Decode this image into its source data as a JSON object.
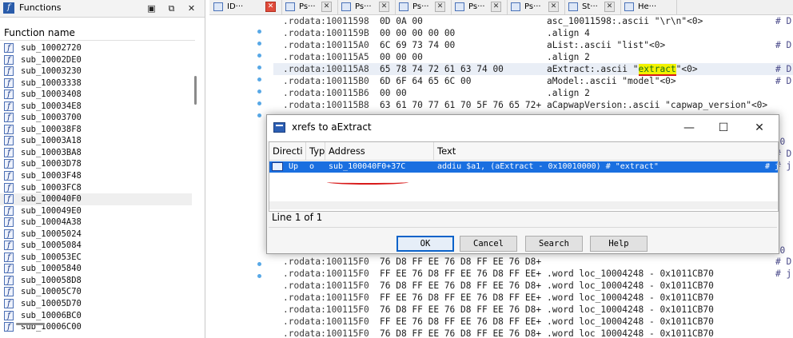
{
  "functions_pane": {
    "title": "Functions",
    "column_header": "Function name",
    "buttons": {
      "maximize": "▣",
      "restore": "⧉",
      "close": "✕"
    },
    "items": [
      "sub_10002720",
      "sub_10002DE0",
      "sub_10003230",
      "sub_10003338",
      "sub_10003408",
      "sub_100034E8",
      "sub_10003700",
      "sub_100038F8",
      "sub_10003A18",
      "sub_10003BA8",
      "sub_10003D78",
      "sub_10003F48",
      "sub_10003FC8",
      "sub_100040F0",
      "sub_100049E0",
      "sub_10004A38",
      "sub_10005024",
      "sub_10005084",
      "sub_100053EC",
      "sub_10005840",
      "sub_100058D8",
      "sub_10005C70",
      "sub_10005D70",
      "sub_10006BC0",
      "sub_10006C00"
    ],
    "selected_index": 13,
    "icon_glyph": "f"
  },
  "tabs": [
    {
      "label": "ID···",
      "close": "✕",
      "close_red": true
    },
    {
      "label": "Ps···",
      "close": "✕"
    },
    {
      "label": "Ps···",
      "close": "✕"
    },
    {
      "label": "Ps···",
      "close": "✕"
    },
    {
      "label": "Ps···",
      "close": "✕"
    },
    {
      "label": "Ps···",
      "close": "✕"
    },
    {
      "label": "St···",
      "close": "✕"
    },
    {
      "label": "He···",
      "close": ""
    }
  ],
  "disassembly": {
    "lines": [
      {
        "addr": ".rodata:10011598",
        "bytes": "0D 0A 00",
        "code": "asc_10011598:.ascii \"\\r\\n\"<0>",
        "comment": "# D"
      },
      {
        "addr": ".rodata:1001159B",
        "bytes": "00 00 00 00 00",
        "code": ".align 4",
        "comment": ""
      },
      {
        "addr": ".rodata:100115A0",
        "bytes": "6C 69 73 74 00",
        "code": "aList:.ascii \"list\"<0>",
        "comment": "# D"
      },
      {
        "addr": ".rodata:100115A5",
        "bytes": "00 00 00",
        "code": ".align 2",
        "comment": ""
      },
      {
        "addr": ".rodata:100115A8",
        "bytes": "65 78 74 72 61 63 74 00",
        "code_pre": "aExtract:.ascii \"",
        "code_hl": "extract",
        "code_post": "\"<0>",
        "comment": "# D",
        "highlight": true
      },
      {
        "addr": ".rodata:100115B0",
        "bytes": "6D 6F 64 65 6C 00",
        "code": "aModel:.ascii \"model\"<0>",
        "comment": "# D"
      },
      {
        "addr": ".rodata:100115B6",
        "bytes": "00 00",
        "code": ".align 2",
        "comment": ""
      },
      {
        "addr": ".rodata:100115B8",
        "bytes": "63 61 70 77 61 70 5F 76 65 72+",
        "code": "aCapwapVersion:.ascii \"capwap_version\"<0>",
        "comment": ""
      }
    ],
    "lower_lines": [
      {
        "addr": ".rodata:100115F0",
        "bytes": "76 D8 FF EE 76 D8 FF EE 76 D8+",
        "code": "",
        "comment": "# D"
      },
      {
        "addr": ".rodata:100115F0",
        "bytes": "FF EE 76 D8 FF EE 76 D8 FF EE+",
        "code": ".word loc_10004248 - 0x1011CB70",
        "comment": "# j"
      },
      {
        "addr": ".rodata:100115F0",
        "bytes": "76 D8 FF EE 76 D8 FF EE 76 D8+",
        "code": ".word loc_10004248 - 0x1011CB70",
        "comment": ""
      },
      {
        "addr": ".rodata:100115F0",
        "bytes": "FF EE 76 D8 FF EE 76 D8 FF EE+",
        "code": ".word loc_10004248 - 0x1011CB70",
        "comment": ""
      },
      {
        "addr": ".rodata:100115F0",
        "bytes": "76 D8 FF EE 76 D8 FF EE 76 D8+",
        "code": ".word loc_10004248 - 0x1011CB70",
        "comment": ""
      },
      {
        "addr": ".rodata:100115F0",
        "bytes": "FF EE 76 D8 FF EE 76 D8 FF EE+",
        "code": ".word loc_10004248 - 0x1011CB70",
        "comment": ""
      },
      {
        "addr": ".rodata:100115F0",
        "bytes": "76 D8 FF EE 76 D8 FF EE 76 D8+",
        "code": ".word loc_10004248 - 0x1011CB70",
        "comment": ""
      }
    ],
    "side_fragments": [
      "370",
      "# D",
      "# j",
      "370"
    ]
  },
  "xrefs_dialog": {
    "title": "xrefs to aExtract",
    "window_buttons": {
      "minimize": "—",
      "maximize": "☐",
      "close": "✕"
    },
    "columns": [
      "Directi",
      "Typ",
      "Address",
      "Text"
    ],
    "rows": [
      {
        "direction": "Up",
        "type": "o",
        "address": "sub_100040F0+37C",
        "text": "addiu   $a1, (aExtract - 0x10010000) # \"extract\"",
        "trail": "# j"
      }
    ],
    "status": "Line 1 of 1",
    "buttons": {
      "ok": "OK",
      "cancel": "Cancel",
      "search": "Search",
      "help": "Help"
    }
  },
  "colors": {
    "selection": "#1a6fe0",
    "annotation": "#d81a1a",
    "highlight": "#f2f200",
    "gutter_dot": "#58a8e6"
  }
}
